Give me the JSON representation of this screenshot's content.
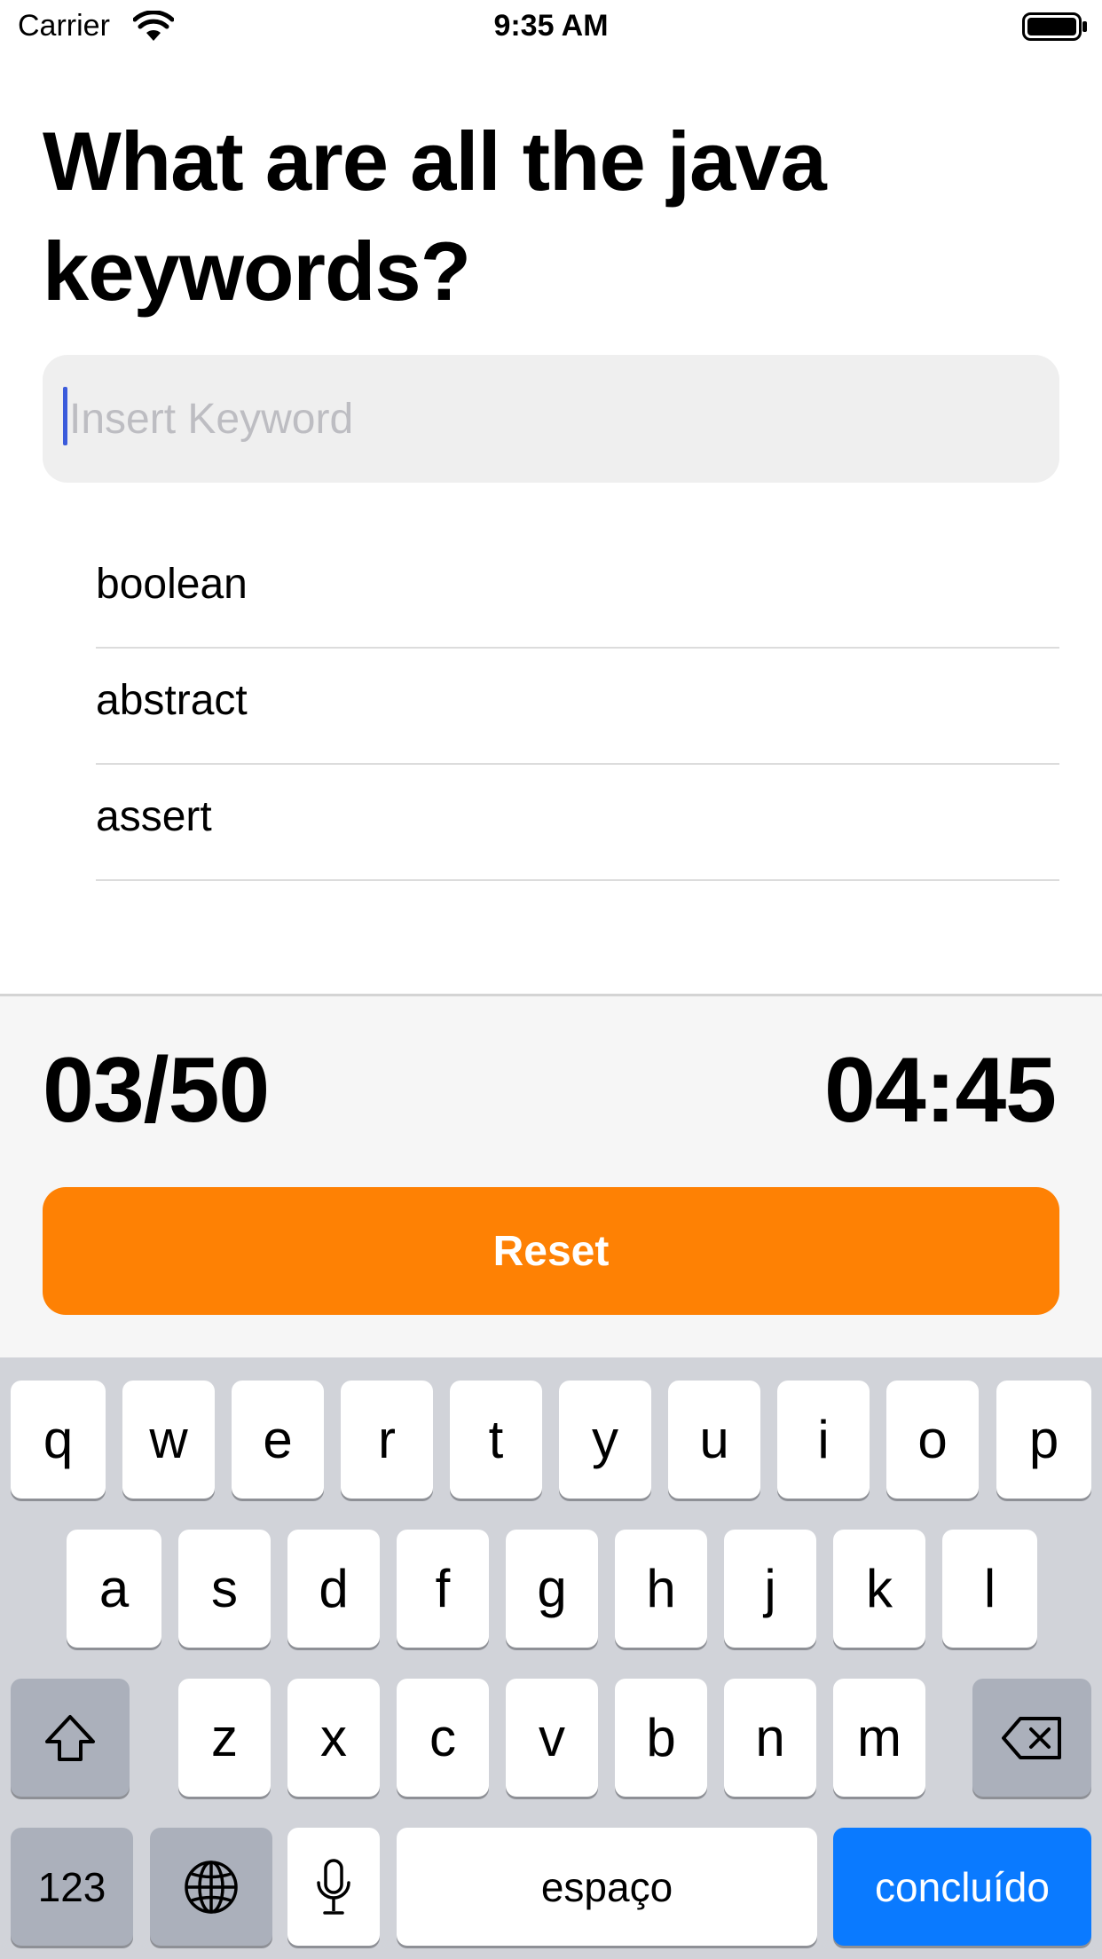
{
  "status_bar": {
    "carrier": "Carrier",
    "time": "9:35 AM"
  },
  "page": {
    "title": "What are all the java keywords?"
  },
  "keyword_input": {
    "placeholder": "Insert Keyword",
    "value": ""
  },
  "keywords": [
    "boolean",
    "abstract",
    "assert"
  ],
  "footer": {
    "score": "03/50",
    "timer": "04:45",
    "reset_label": "Reset"
  },
  "colors": {
    "accent_orange": "#fe8104",
    "keyboard_done_blue": "#0a7aff",
    "cursor_blue": "#3b5bdb"
  },
  "keyboard": {
    "row1": [
      "q",
      "w",
      "e",
      "r",
      "t",
      "y",
      "u",
      "i",
      "o",
      "p"
    ],
    "row2": [
      "a",
      "s",
      "d",
      "f",
      "g",
      "h",
      "j",
      "k",
      "l"
    ],
    "row3": [
      "z",
      "x",
      "c",
      "v",
      "b",
      "n",
      "m"
    ],
    "numbers_label": "123",
    "space_label": "espaço",
    "done_label": "concluído",
    "icons": [
      "shift-icon",
      "backspace-icon",
      "globe-icon",
      "microphone-icon"
    ]
  }
}
